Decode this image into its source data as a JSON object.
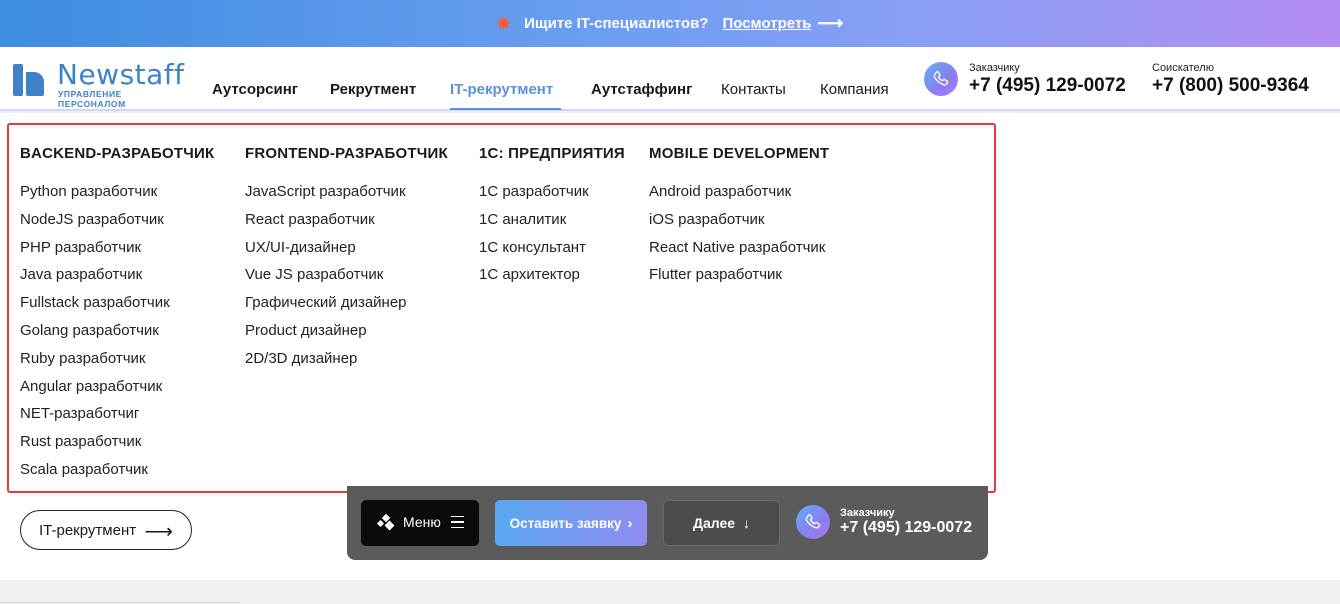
{
  "banner": {
    "text": "Ищите IT-специалистов?",
    "link": "Посмотреть"
  },
  "logo": {
    "name": "Newstaff",
    "tagline": "УПРАВЛЕНИЕ ПЕРСОНАЛОМ"
  },
  "nav": [
    {
      "label": "Аутсорсинг",
      "style": "bold"
    },
    {
      "label": "Рекрутмент",
      "style": "bold"
    },
    {
      "label": "IT-рекрутмент",
      "style": "active"
    },
    {
      "label": "Аутстаффинг",
      "style": "bold"
    },
    {
      "label": "Контакты",
      "style": "normal"
    },
    {
      "label": "Компания",
      "style": "normal"
    }
  ],
  "contacts": [
    {
      "label": "Заказчику",
      "number": "+7 (495) 129-0072"
    },
    {
      "label": "Соискателю",
      "number": "+7 (800) 500-9364"
    }
  ],
  "columns": [
    {
      "title": "BACKEND-РАЗРАБОТЧИК",
      "items": [
        "Python разработчик",
        "NodeJS разработчик",
        "PHP разработчик",
        "Java разработчик",
        "Fullstack разработчик",
        "Golang разработчик",
        "Ruby разработчик",
        "Angular разработчик",
        "NET-разработчиг",
        "Rust разработчик",
        "Scala разработчик"
      ]
    },
    {
      "title": "FRONTEND-РАЗРАБОТЧИК",
      "items": [
        "JavaScript разработчик",
        "React разработчик",
        "UX/UI-дизайнер",
        "Vue JS разработчик",
        "Графический дизайнер",
        "Product дизайнер",
        "2D/3D дизайнер"
      ]
    },
    {
      "title": "1С: ПРЕДПРИЯТИЯ",
      "items": [
        "1С разработчик",
        "1С аналитик",
        "1С консультант",
        "1С архитектор"
      ]
    },
    {
      "title": "MOBILE DEVELOPMENT",
      "items": [
        "Android разработчик",
        "iOS разработчик",
        "React Native разработчик",
        "Flutter разработчик"
      ]
    }
  ],
  "it_button": "IT-рекрутмент",
  "floatbar": {
    "menu": "Меню",
    "order": "Оставить заявку",
    "next": "Далее",
    "label": "Заказчику",
    "number": "+7 (495) 129-0072"
  },
  "colors": {
    "accent": "#5b8fe0",
    "brand": "#3f82c9",
    "highlight_border": "#e23b3b"
  }
}
